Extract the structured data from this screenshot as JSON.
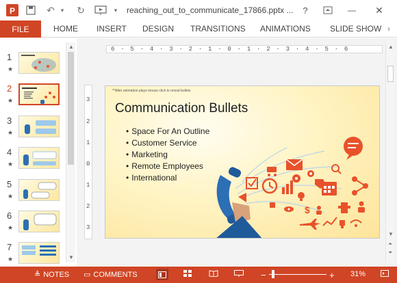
{
  "titlebar": {
    "file_name": "reaching_out_to_communicate_17866.pptx ...",
    "help_label": "?",
    "minimize_label": "—",
    "close_label": "✕"
  },
  "ribbon": {
    "file_label": "FILE",
    "tabs": [
      "HOME",
      "INSERT",
      "DESIGN",
      "TRANSITIONS",
      "ANIMATIONS",
      "SLIDE SHOW"
    ]
  },
  "thumbnails": [
    {
      "num": "1",
      "star": "★"
    },
    {
      "num": "2",
      "star": "★",
      "active": true
    },
    {
      "num": "3",
      "star": "★"
    },
    {
      "num": "4",
      "star": "★"
    },
    {
      "num": "5",
      "star": "★"
    },
    {
      "num": "6",
      "star": "★"
    },
    {
      "num": "7",
      "star": "★"
    }
  ],
  "ruler": {
    "horizontal": "6 · 5 · 4 · 3 · 2 · 1 · 0 · 1 · 2 · 3 · 4 · 5 · 6",
    "vertical": [
      "3",
      "2",
      "1",
      "0",
      "1",
      "2",
      "3"
    ]
  },
  "slide": {
    "note": "**After animation plays mouse click to reveal bullets",
    "title": "Communication Bullets",
    "bullets": [
      "Space For An Outline",
      "Customer Service",
      "Marketing",
      "Remote Employees",
      "International"
    ]
  },
  "statusbar": {
    "notes_label": "NOTES",
    "comments_label": "COMMENTS",
    "zoom_label": "31%",
    "zoom_minus": "−",
    "zoom_plus": "+"
  },
  "colors": {
    "accent": "#d04525",
    "icon_orange": "#e8522a",
    "phone_blue": "#2c6fb5"
  }
}
